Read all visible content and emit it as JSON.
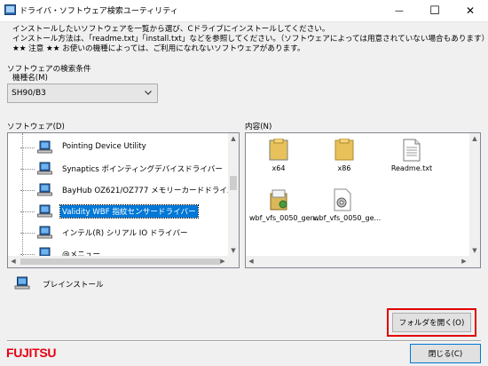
{
  "window": {
    "title": "ドライバ・ソフトウェア検索ユーティリティ",
    "minimize_glyph": "—",
    "maximize_glyph": "☐",
    "close_glyph": "✕"
  },
  "instructions": [
    "インストールしたいソフトウェアを一覧から選び、Cドライブにインストールしてください。",
    "インストール方法は、「readme.txt」「install.txt」などを参照してください。（ソフトウェアによっては用意されていない場合もあります）",
    "★★ 注意 ★★ お使いの機種によっては、ご利用になれないソフトウェアがあります。"
  ],
  "search": {
    "section_label": "ソフトウェアの検索条件",
    "model_label": "機種名(M)",
    "model_value": "SH90/B3"
  },
  "software": {
    "label": "ソフトウェア(D)",
    "items": [
      {
        "label": "Pointing Device Utility",
        "selected": false
      },
      {
        "label": "Synaptics ポインティングデバイスドライバー",
        "selected": false
      },
      {
        "label": "BayHub OZ621/OZ777 メモリーカードドライバー",
        "selected": false
      },
      {
        "label": "Validity WBF 指紋センサードライバー",
        "selected": true
      },
      {
        "label": "インテル(R) シリアル IO ドライバー",
        "selected": false
      },
      {
        "label": "@メニュー",
        "selected": false
      }
    ]
  },
  "contents": {
    "label": "内容(N)",
    "files": [
      {
        "name": "x64",
        "icon": "folder-icon"
      },
      {
        "name": "x86",
        "icon": "folder-icon"
      },
      {
        "name": "Readme.txt",
        "icon": "text-file-icon"
      },
      {
        "name": "wbf_vfs_0050_gen...",
        "icon": "setup-package-icon"
      },
      {
        "name": "wbf_vfs_0050_ge...",
        "icon": "settings-file-icon"
      }
    ]
  },
  "preinstall_label": "プレインストール",
  "buttons": {
    "open_folder": "フォルダを開く(O)",
    "close": "閉じる(C)"
  },
  "brand": "FUJITSU",
  "colors": {
    "selection": "#0078d7",
    "highlight_border": "#e00000",
    "brand_red": "#e60012"
  }
}
